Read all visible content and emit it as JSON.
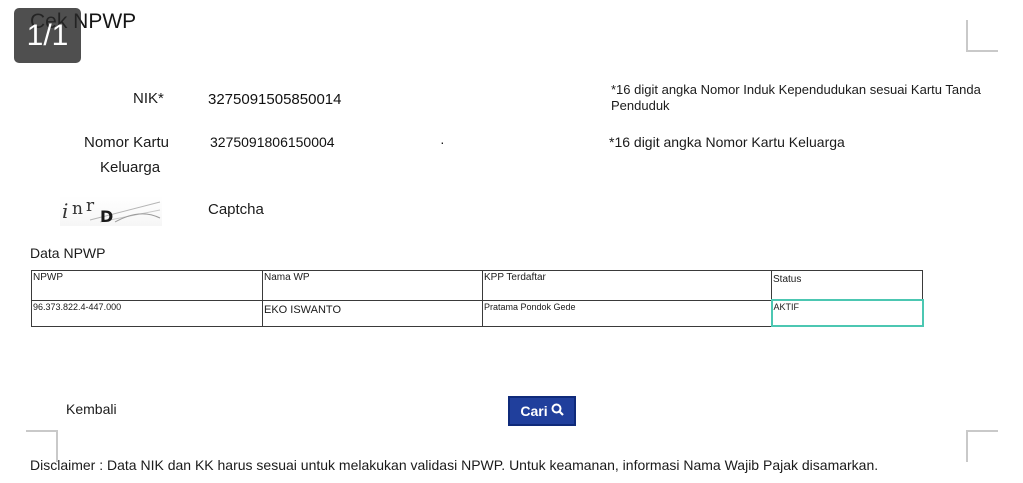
{
  "page": {
    "title": "Cek NPWP",
    "page_indicator": "1/1"
  },
  "form": {
    "nik_label": "NIK*",
    "nik_value": "3275091505850014",
    "nik_hint": "*16 digit angka Nomor Induk Kependudukan sesuai Kartu Tanda Penduduk",
    "kk_label_line1": "Nomor Kartu",
    "kk_label_line2": "Keluarga",
    "kk_value": "3275091806150004",
    "kk_hint": "*16 digit angka Nomor Kartu Keluarga",
    "captcha_label": "Captcha",
    "captcha_text": "inrD"
  },
  "result": {
    "section_title": "Data NPWP",
    "columns": [
      "NPWP",
      "Nama WP",
      "KPP Terdaftar",
      "Status"
    ],
    "rows": [
      [
        "96.373.822.4-447.000",
        "EKO ISWANTO",
        "Pratama Pondok Gede",
        "AKTIF"
      ]
    ]
  },
  "actions": {
    "back_label": "Kembali",
    "search_label": "Cari",
    "search_icon": "search-icon"
  },
  "disclaimer": "Disclaimer : Data NIK dan KK harus sesuai untuk melakukan validasi NPWP. Untuk keamanan, informasi Nama Wajib Pajak disamarkan."
}
